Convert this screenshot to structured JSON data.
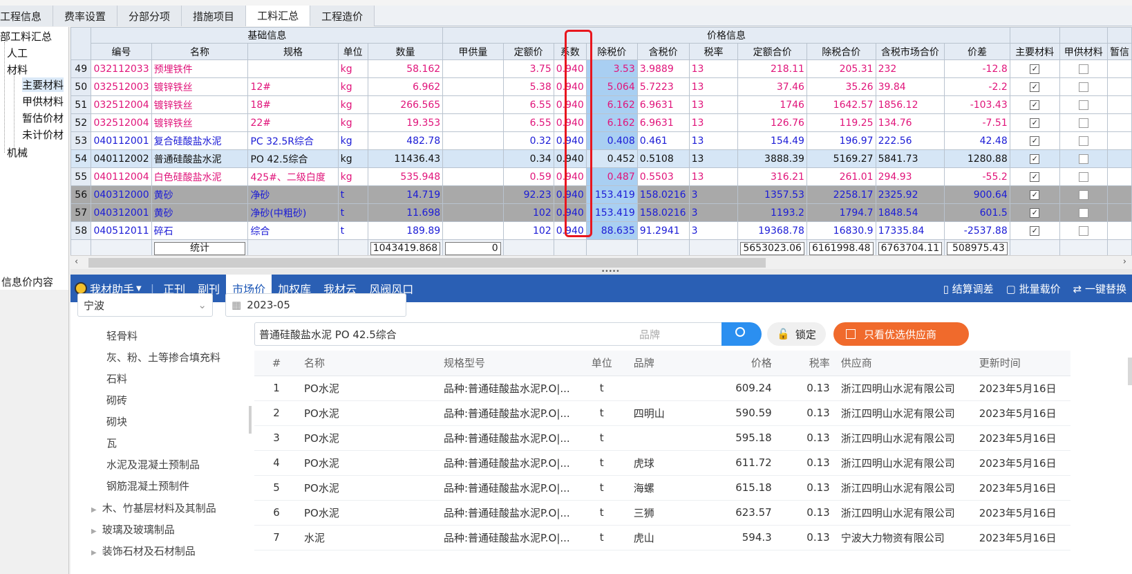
{
  "tabs": [
    "工程信息",
    "费率设置",
    "分部分项",
    "措施项目",
    "工料汇总",
    "工程造价"
  ],
  "tree": {
    "root": "部工料汇总",
    "items": [
      "人工",
      "材料",
      "主要材料",
      "甲供材料",
      "暂估价材",
      "未计价材",
      "机械"
    ]
  },
  "grid": {
    "group_basic": "基础信息",
    "group_price": "价格信息",
    "headers": [
      "编号",
      "名称",
      "规格",
      "单位",
      "数量",
      "甲供量",
      "定额价",
      "系数",
      "除税价",
      "含税价",
      "税率",
      "定额合价",
      "除税合价",
      "含税市场合价",
      "价差",
      "主要材料",
      "甲供材料",
      "暂信"
    ],
    "rows": [
      {
        "n": "49",
        "code": "032112033",
        "name": "预埋铁件",
        "spec": "",
        "unit": "kg",
        "qty": "58.162",
        "jg": "",
        "de": "3.75",
        "xs": "0.940",
        "cs": "3.53",
        "hs": "3.9889",
        "sl": "13",
        "deh": "218.11",
        "csh": "205.31",
        "hsh": "232",
        "jc": "-12.8",
        "main": true,
        "jia": false
      },
      {
        "n": "50",
        "code": "032512003",
        "name": "镀锌铁丝",
        "spec": "12#",
        "unit": "kg",
        "qty": "6.962",
        "jg": "",
        "de": "5.38",
        "xs": "0.940",
        "cs": "5.064",
        "hs": "5.7223",
        "sl": "13",
        "deh": "37.46",
        "csh": "35.26",
        "hsh": "39.84",
        "jc": "-2.2",
        "main": true,
        "jia": false
      },
      {
        "n": "51",
        "code": "032512004",
        "name": "镀锌铁丝",
        "spec": "18#",
        "unit": "kg",
        "qty": "266.565",
        "jg": "",
        "de": "6.55",
        "xs": "0.940",
        "cs": "6.162",
        "hs": "6.9631",
        "sl": "13",
        "deh": "1746",
        "csh": "1642.57",
        "hsh": "1856.12",
        "jc": "-103.43",
        "main": true,
        "jia": false
      },
      {
        "n": "52",
        "code": "032512004",
        "name": "镀锌铁丝",
        "spec": "22#",
        "unit": "kg",
        "qty": "19.353",
        "jg": "",
        "de": "6.55",
        "xs": "0.940",
        "cs": "6.162",
        "hs": "6.9631",
        "sl": "13",
        "deh": "126.76",
        "csh": "119.25",
        "hsh": "134.76",
        "jc": "-7.51",
        "main": true,
        "jia": false
      },
      {
        "n": "53",
        "code": "040112001",
        "name": "复合硅酸盐水泥",
        "spec": "PC 32.5R综合",
        "unit": "kg",
        "qty": "482.78",
        "jg": "",
        "de": "0.32",
        "xs": "0.940",
        "cs": "0.408",
        "hs": "0.461",
        "sl": "13",
        "deh": "154.49",
        "csh": "196.97",
        "hsh": "222.56",
        "jc": "42.48",
        "main": true,
        "jia": false
      },
      {
        "n": "54",
        "code": "040112002",
        "name": "普通硅酸盐水泥",
        "spec": "PO 42.5综合",
        "unit": "kg",
        "qty": "11436.43",
        "jg": "",
        "de": "0.34",
        "xs": "0.940",
        "cs": "0.452",
        "hs": "0.5108",
        "sl": "13",
        "deh": "3888.39",
        "csh": "5169.27",
        "hsh": "5841.73",
        "jc": "1280.88",
        "main": true,
        "jia": false
      },
      {
        "n": "55",
        "code": "040112004",
        "name": "白色硅酸盐水泥",
        "spec": "425#、二级白度",
        "unit": "kg",
        "qty": "535.948",
        "jg": "",
        "de": "0.59",
        "xs": "0.940",
        "cs": "0.487",
        "hs": "0.5503",
        "sl": "13",
        "deh": "316.21",
        "csh": "261.01",
        "hsh": "294.93",
        "jc": "-55.2",
        "main": true,
        "jia": false
      },
      {
        "n": "56",
        "code": "040312000",
        "name": "黄砂",
        "spec": "净砂",
        "unit": "t",
        "qty": "14.719",
        "jg": "",
        "de": "92.23",
        "xs": "0.940",
        "cs": "153.419",
        "hs": "158.0216",
        "sl": "3",
        "deh": "1357.53",
        "csh": "2258.17",
        "hsh": "2325.92",
        "jc": "900.64",
        "main": true,
        "jia": false
      },
      {
        "n": "57",
        "code": "040312001",
        "name": "黄砂",
        "spec": "净砂(中粗砂)",
        "unit": "t",
        "qty": "11.698",
        "jg": "",
        "de": "102",
        "xs": "0.940",
        "cs": "153.419",
        "hs": "158.0216",
        "sl": "3",
        "deh": "1193.2",
        "csh": "1794.7",
        "hsh": "1848.54",
        "jc": "601.5",
        "main": true,
        "jia": false
      },
      {
        "n": "58",
        "code": "040512011",
        "name": "碎石",
        "spec": "综合",
        "unit": "t",
        "qty": "189.89",
        "jg": "",
        "de": "102",
        "xs": "0.940",
        "cs": "88.635",
        "hs": "91.2941",
        "sl": "3",
        "deh": "19368.78",
        "csh": "16830.9",
        "hsh": "17335.84",
        "jc": "-2537.88",
        "main": true,
        "jia": false
      }
    ],
    "stat": {
      "label": "统计",
      "qty": "1043419.868",
      "jg": "0",
      "deh": "5653023.06",
      "csh": "6161998.48",
      "hsh": "6763704.11",
      "jc": "508975.43"
    }
  },
  "left_bottom": "信息价内容",
  "panel": {
    "assistant": "我材助手",
    "tabs": [
      "正刊",
      "副刊",
      "市场价",
      "加权库",
      "我材云",
      "风阀风口"
    ],
    "right_actions": [
      "结算调差",
      "批量载价",
      "一键替换"
    ],
    "city": "宁波",
    "date": "2023-05",
    "categories": [
      "轻骨料",
      "灰、粉、土等掺合填充料",
      "石料",
      "砌砖",
      "砌块",
      "瓦",
      "水泥及混凝土预制品",
      "钢筋混凝土预制件"
    ],
    "categories2": [
      "木、竹基层材料及其制品",
      "玻璃及玻璃制品",
      "装饰石材及石材制品"
    ],
    "search_value": "普通硅酸盐水泥 PO 42.5综合",
    "brand_placeholder": "品牌",
    "lock_label": "锁定",
    "prio_label": "只看优选供应商",
    "res_headers": [
      "#",
      "名称",
      "规格型号",
      "单位",
      "品牌",
      "价格",
      "税率",
      "供应商",
      "更新时间"
    ],
    "results": [
      {
        "i": "1",
        "name": "PO水泥",
        "spec": "品种:普通硅酸盐水泥P.O|...",
        "unit": "t",
        "brand": "",
        "price": "609.24",
        "tax": "0.13",
        "vendor": "浙江四明山水泥有限公司",
        "time": "2023年5月16日"
      },
      {
        "i": "2",
        "name": "PO水泥",
        "spec": "品种:普通硅酸盐水泥P.O|...",
        "unit": "t",
        "brand": "四明山",
        "price": "590.59",
        "tax": "0.13",
        "vendor": "浙江四明山水泥有限公司",
        "time": "2023年5月16日"
      },
      {
        "i": "3",
        "name": "PO水泥",
        "spec": "品种:普通硅酸盐水泥P.O|...",
        "unit": "t",
        "brand": "",
        "price": "595.18",
        "tax": "0.13",
        "vendor": "浙江四明山水泥有限公司",
        "time": "2023年5月16日"
      },
      {
        "i": "4",
        "name": "PO水泥",
        "spec": "品种:普通硅酸盐水泥P.O|...",
        "unit": "t",
        "brand": "虎球",
        "price": "611.72",
        "tax": "0.13",
        "vendor": "浙江四明山水泥有限公司",
        "time": "2023年5月16日"
      },
      {
        "i": "5",
        "name": "PO水泥",
        "spec": "品种:普通硅酸盐水泥P.O|...",
        "unit": "t",
        "brand": "海螺",
        "price": "615.18",
        "tax": "0.13",
        "vendor": "浙江四明山水泥有限公司",
        "time": "2023年5月16日"
      },
      {
        "i": "6",
        "name": "PO水泥",
        "spec": "品种:普通硅酸盐水泥P.O|...",
        "unit": "t",
        "brand": "三狮",
        "price": "623.57",
        "tax": "0.13",
        "vendor": "浙江四明山水泥有限公司",
        "time": "2023年5月16日"
      },
      {
        "i": "7",
        "name": "水泥",
        "spec": "品种:普通硅酸盐水泥P.O|...",
        "unit": "t",
        "brand": "虎山",
        "price": "594.3",
        "tax": "0.13",
        "vendor": "宁波大力物资有限公司",
        "time": "2023年5月16日"
      }
    ]
  }
}
